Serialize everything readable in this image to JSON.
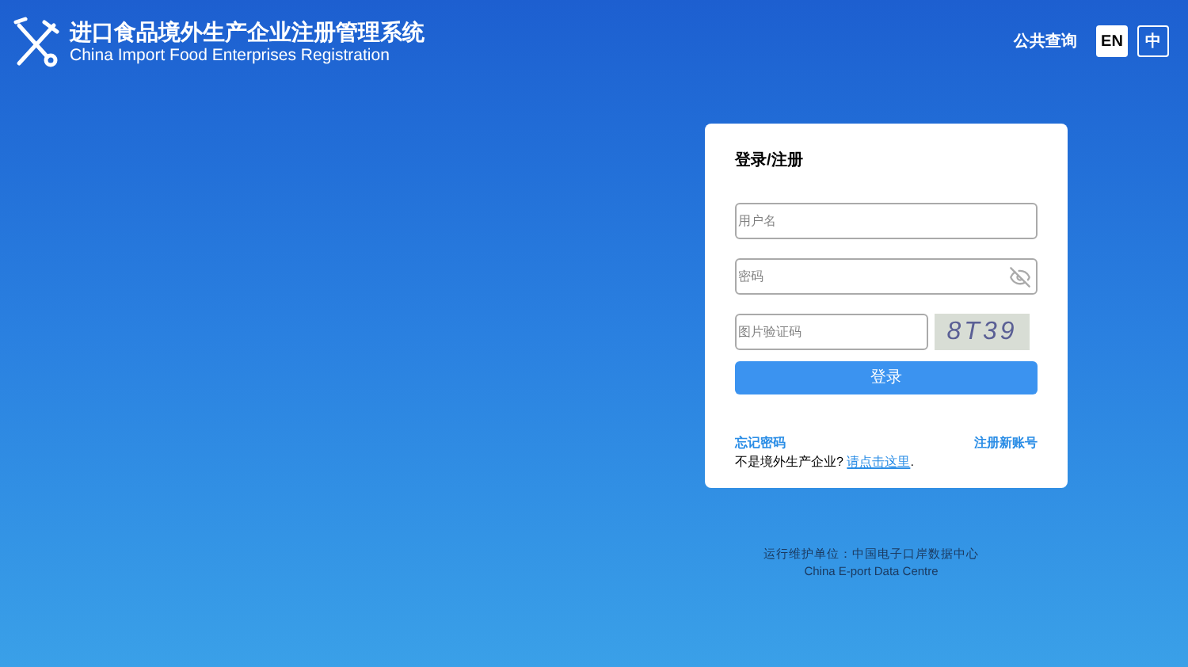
{
  "header": {
    "title": "进口食品境外生产企业注册管理系统",
    "subtitle": "China Import Food Enterprises Registration",
    "public_query": "公共查询",
    "languages": [
      {
        "label": "EN",
        "selected": true
      },
      {
        "label": "中",
        "selected": false
      }
    ]
  },
  "login": {
    "title": "登录/注册",
    "username": {
      "placeholder": "用户名"
    },
    "password": {
      "placeholder": "密码"
    },
    "captcha": {
      "placeholder": "图片验证码",
      "image_text": "8T39"
    },
    "submit": "登录",
    "forgot": "忘记密码",
    "register": "注册新账号",
    "note": "不是境外生产企业?",
    "note_link": "请点击这里",
    "note_end": "."
  },
  "footer": {
    "operator": "运行维护单位：中国电子口岸数据中心",
    "operator_en": "China E-port Data Centre"
  }
}
